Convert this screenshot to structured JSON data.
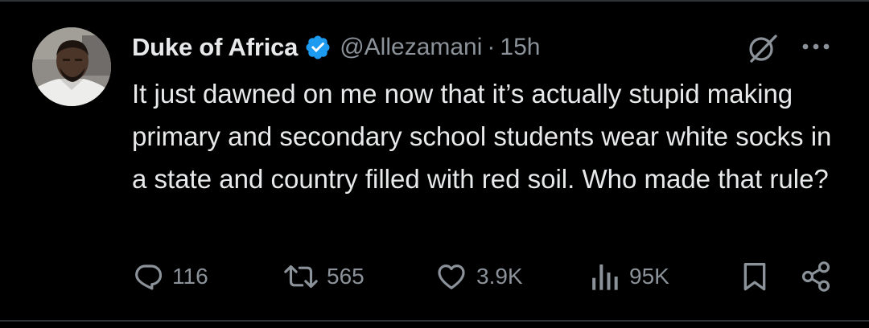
{
  "tweet": {
    "author": {
      "display_name": "Duke of Africa",
      "handle": "@Allezamani",
      "verified": true,
      "avatar_icon": "user-avatar-photo"
    },
    "separator": "·",
    "time": "15h",
    "text": "It just dawned on me now that it’s actually stupid making primary and secondary school students wear white socks in a state and country filled with red soil. Who made that rule?",
    "header_icons": [
      "grok-icon",
      "more-icon"
    ],
    "actions": {
      "replies": {
        "icon": "reply-icon",
        "count": "116"
      },
      "reposts": {
        "icon": "repost-icon",
        "count": "565"
      },
      "likes": {
        "icon": "like-icon",
        "count": "3.9K"
      },
      "views": {
        "icon": "views-icon",
        "count": "95K"
      },
      "bookmark": {
        "icon": "bookmark-icon"
      },
      "share": {
        "icon": "share-icon"
      }
    }
  },
  "colors": {
    "background": "#000000",
    "primary_text": "#e7e9ea",
    "secondary_text": "#8b9299",
    "verified_badge": "#1d9bf0",
    "divider": "#2f3336"
  }
}
